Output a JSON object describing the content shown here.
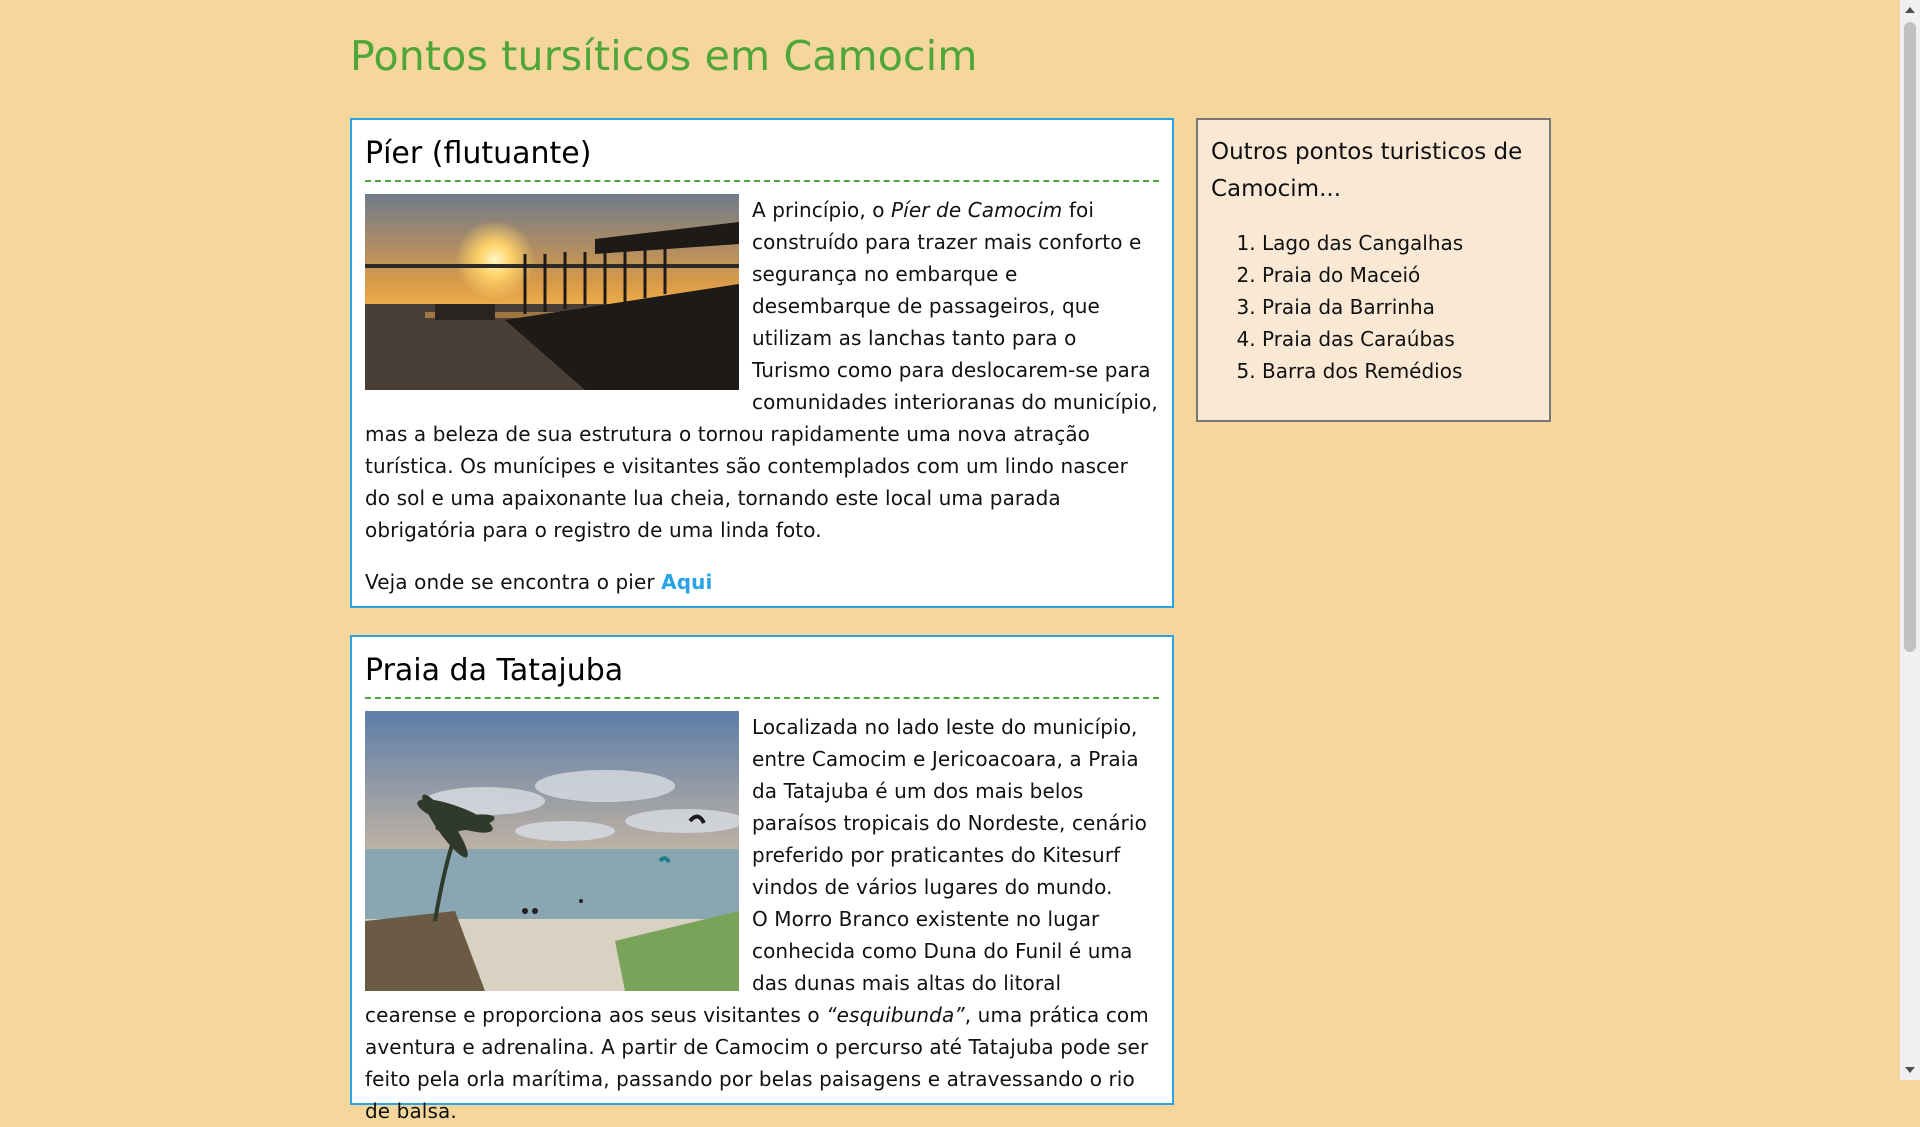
{
  "page": {
    "title": "Pontos tursíticos em Camocim"
  },
  "articles": [
    {
      "heading": "Píer (flutuante)",
      "image_alt": "Píer de Camocim ao pôr do sol",
      "text_before_em": "A princípio, o ",
      "em_text": "Píer de Camocim",
      "text_after_em": " foi construído para trazer mais conforto e segurança no embarque e desembarque de passageiros, que utilizam as lanchas tanto para o Turismo como para deslocarem-se para comunidades interioranas do município, mas a beleza de sua estrutura o tornou rapidamente uma nova atração turística. Os munícipes e visitantes são contemplados com um lindo nascer do sol e uma apaixonante lua cheia, tornando este local uma parada obrigatória para o registro de uma linda foto.",
      "link_prefix": "Veja onde se encontra o pier ",
      "link_label": "Aqui"
    },
    {
      "heading": "Praia da Tatajuba",
      "image_alt": "Praia da Tatajuba com coqueiro e kitesurf",
      "paragraph1": "Localizada no lado leste do município, entre Camocim e Jericoacoara, a Praia da Tatajuba é um dos mais belos paraísos tropicais do Nordeste, cenário preferido por praticantes do Kitesurf vindos de vários lugares do mundo.",
      "p2_before_em": "O Morro Branco existente no lugar conhecida como Duna do Funil é uma das dunas mais altas do litoral cearense e proporciona aos seus visitantes o ",
      "p2_em": "“esquibunda”",
      "p2_after_em": ", uma prática com aventura e adrenalina. A partir de Camocim o percurso até Tatajuba pode ser feito pela orla marítima, passando por belas paisagens e atravessando o rio de balsa."
    }
  ],
  "sidebar": {
    "title": "Outros pontos turisticos de Camocim...",
    "items": [
      "Lago das Cangalhas",
      "Praia do Maceió",
      "Praia da Barrinha",
      "Praia das Caraúbas",
      "Barra dos Remédios"
    ]
  },
  "colors": {
    "background": "#f5d79d",
    "title_green": "#4ea53a",
    "card_border_blue": "#2aa3e6",
    "sidebar_background": "#f9e8d3"
  }
}
